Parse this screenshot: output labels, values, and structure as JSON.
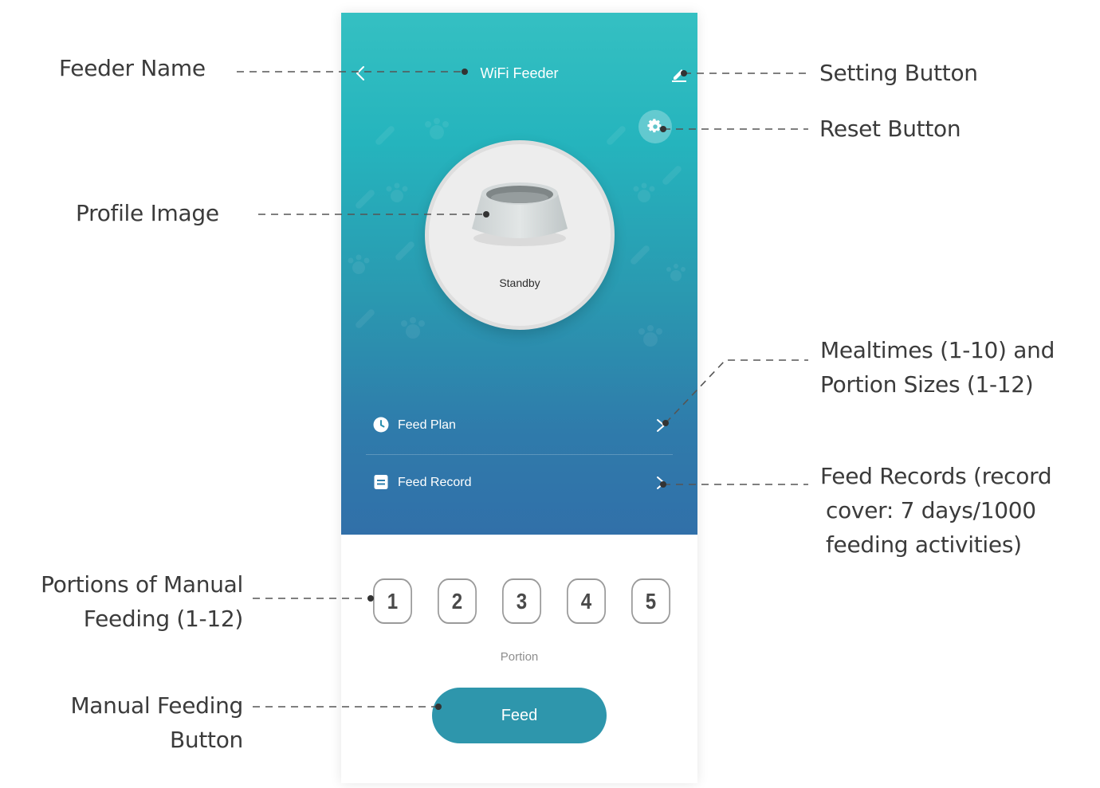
{
  "app": {
    "header": {
      "title": "WiFi Feeder",
      "back_icon": "chevron-left-icon",
      "edit_icon": "pencil-icon"
    },
    "reset_icon": "gear-icon",
    "profile": {
      "status": "Standby",
      "image": "food-bowl"
    },
    "menu": [
      {
        "label": "Feed Plan",
        "icon": "clock-icon"
      },
      {
        "label": "Feed Record",
        "icon": "document-icon"
      }
    ],
    "portions": [
      "1",
      "2",
      "3",
      "4",
      "5"
    ],
    "portion_caption": "Portion",
    "feed_button": "Feed",
    "colors": {
      "gradient_top": "#35c0c2",
      "gradient_bottom": "#3170a9",
      "feed_button": "#2e96ac"
    }
  },
  "annotations": {
    "feeder_name": "Feeder Name",
    "setting_button": "Setting Button",
    "reset_button": "Reset Button",
    "profile_image": "Profile Image",
    "mealtimes": [
      "Mealtimes (1-10) and",
      "Portion Sizes (1-12)"
    ],
    "feed_records": [
      "Feed Records (record",
      "cover: 7 days/1000",
      "feeding activities)"
    ],
    "manual_portions": [
      "Portions of Manual",
      "Feeding (1-12)"
    ],
    "manual_feed": [
      "Manual Feeding",
      "Button"
    ]
  }
}
